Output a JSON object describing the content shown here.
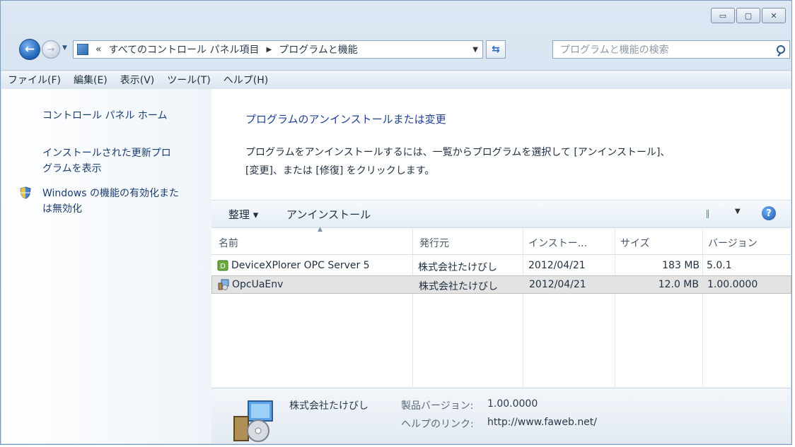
{
  "window_buttons": {
    "minimize": "▭",
    "maximize": "▢",
    "close": "✕"
  },
  "nav": {
    "back": "←",
    "forward": "→",
    "breadcrumb_prefix": "«",
    "breadcrumb": [
      "すべてのコントロール パネル項目",
      "プログラムと機能"
    ],
    "search_placeholder": "プログラムと機能の検索"
  },
  "menu": [
    "ファイル(F)",
    "編集(E)",
    "表示(V)",
    "ツール(T)",
    "ヘルプ(H)"
  ],
  "sidebar": {
    "home": "コントロール パネル ホーム",
    "updates_line1": "インストールされた更新プロ",
    "updates_line2": "グラムを表示",
    "features_line1": "Windows の機能の有効化また",
    "features_line2": "は無効化"
  },
  "main": {
    "heading": "プログラムのアンインストールまたは変更",
    "desc_line1": "プログラムをアンインストールするには、一覧からプログラムを選択して [アンインストール]、",
    "desc_line2": "[変更]、または [修復] をクリックします。"
  },
  "toolbar": {
    "organize": "整理 ▾",
    "uninstall": "アンインストール",
    "view_drop": "▼",
    "help": "?"
  },
  "columns": [
    "名前",
    "発行元",
    "インストー...",
    "サイズ",
    "バージョン"
  ],
  "programs": [
    {
      "name": "DeviceXPlorer OPC Server 5",
      "publisher": "株式会社たけびし",
      "installed": "2012/04/21",
      "size": "183 MB",
      "version": "5.0.1",
      "selected": false
    },
    {
      "name": "OpcUaEnv",
      "publisher": "株式会社たけびし",
      "installed": "2012/04/21",
      "size": "12.0 MB",
      "version": "1.00.0000",
      "selected": true
    }
  ],
  "details": {
    "publisher": "株式会社たけびし",
    "label_version": "製品バージョン:",
    "version": "1.00.0000",
    "label_help": "ヘルプのリンク:",
    "help_link": "http://www.faweb.net/"
  }
}
